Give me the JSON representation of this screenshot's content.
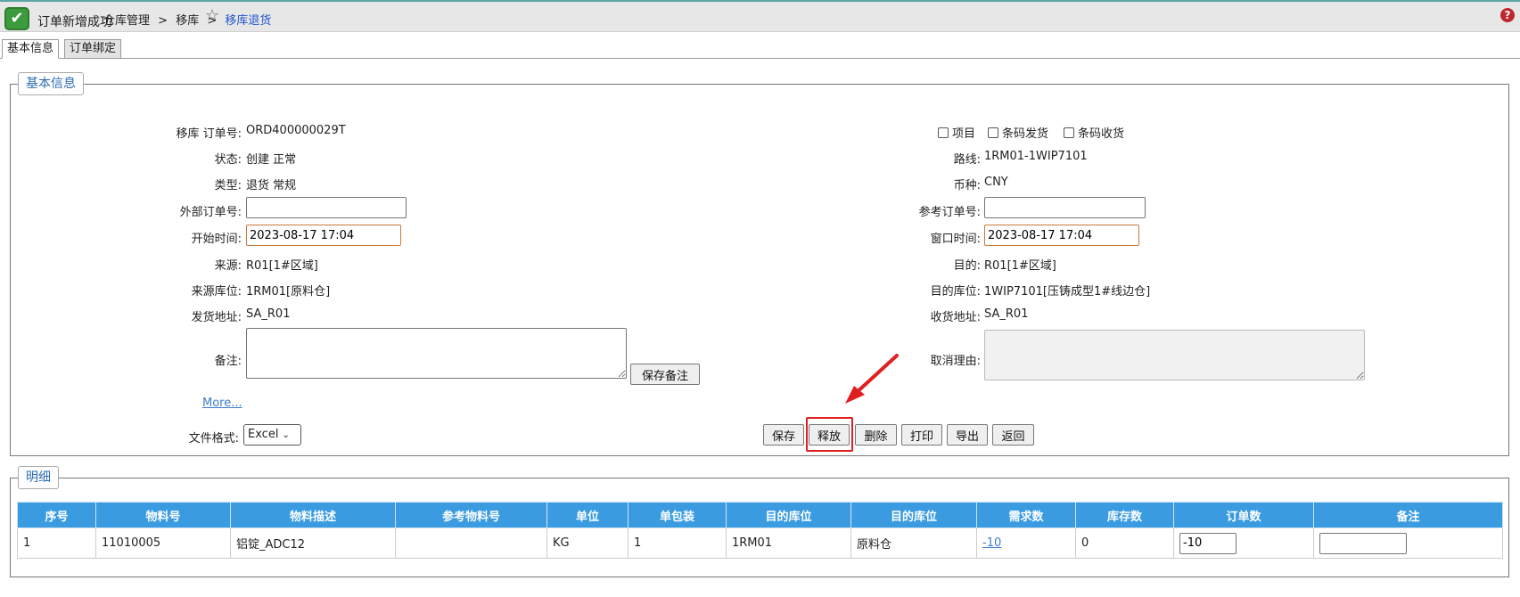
{
  "toast": {
    "message": "订单新增成功"
  },
  "breadcrumb": {
    "items": [
      "仓库管理",
      "移库"
    ],
    "separator": ">",
    "current": "移库退货"
  },
  "tabs": [
    "基本信息",
    "订单绑定"
  ],
  "basic": {
    "legend": "基本信息",
    "left": {
      "order_no": {
        "label": "移库 订单号:",
        "value": "ORD400000029T"
      },
      "status": {
        "label": "状态:",
        "value": "创建 正常"
      },
      "type": {
        "label": "类型:",
        "value": "退货 常规"
      },
      "external_order": {
        "label": "外部订单号:",
        "value": ""
      },
      "start_time": {
        "label": "开始时间:",
        "value": "2023-08-17 17:04"
      },
      "source": {
        "label": "来源:",
        "value": "R01[1#区域]"
      },
      "source_location": {
        "label": "来源库位:",
        "value": "1RM01[原料仓]"
      },
      "ship_address": {
        "label": "发货地址:",
        "value": "SA_R01"
      },
      "remark": {
        "label": "备注:",
        "value": ""
      },
      "save_remark_button": "保存备注",
      "more_link": "More...",
      "file_format": {
        "label": "文件格式:",
        "selected": "Excel"
      }
    },
    "right": {
      "checkboxes": [
        "项目",
        "条码发货",
        "条码收货"
      ],
      "route": {
        "label": "路线:",
        "value": "1RM01-1WIP7101"
      },
      "currency": {
        "label": "币种:",
        "value": "CNY"
      },
      "ref_order": {
        "label": "参考订单号:",
        "value": ""
      },
      "window_time": {
        "label": "窗口时间:",
        "value": "2023-08-17 17:04"
      },
      "destination": {
        "label": "目的:",
        "value": "R01[1#区域]"
      },
      "dest_location": {
        "label": "目的库位:",
        "value": "1WIP7101[压铸成型1#线边仓]"
      },
      "receive_address": {
        "label": "收货地址:",
        "value": "SA_R01"
      },
      "cancel_reason": {
        "label": "取消理由:",
        "value": ""
      }
    },
    "actions": [
      "保存",
      "释放",
      "删除",
      "打印",
      "导出",
      "返回"
    ]
  },
  "detail": {
    "legend": "明细",
    "columns": [
      "序号",
      "物料号",
      "物料描述",
      "参考物料号",
      "单位",
      "单包装",
      "目的库位",
      "目的库位",
      "需求数",
      "库存数",
      "订单数",
      "备注"
    ],
    "rows": [
      {
        "seq": "1",
        "material": "11010005",
        "desc": "铝锭_ADC12",
        "ref_material": "",
        "unit": "KG",
        "pack": "1",
        "dest_code": "1RM01",
        "dest_name": "原料仓",
        "demand": "-10",
        "stock": "0",
        "order_qty": "-10",
        "remark": ""
      }
    ]
  },
  "colors": {
    "accent": "#3a9be0",
    "highlight": "#e02020",
    "legend_text": "#2c6bb3",
    "toast_green": "#3c9b3c"
  },
  "icons": {
    "toast": "check-icon",
    "favorite": "star-icon",
    "help": "help-icon",
    "annotation": "arrow-icon"
  }
}
